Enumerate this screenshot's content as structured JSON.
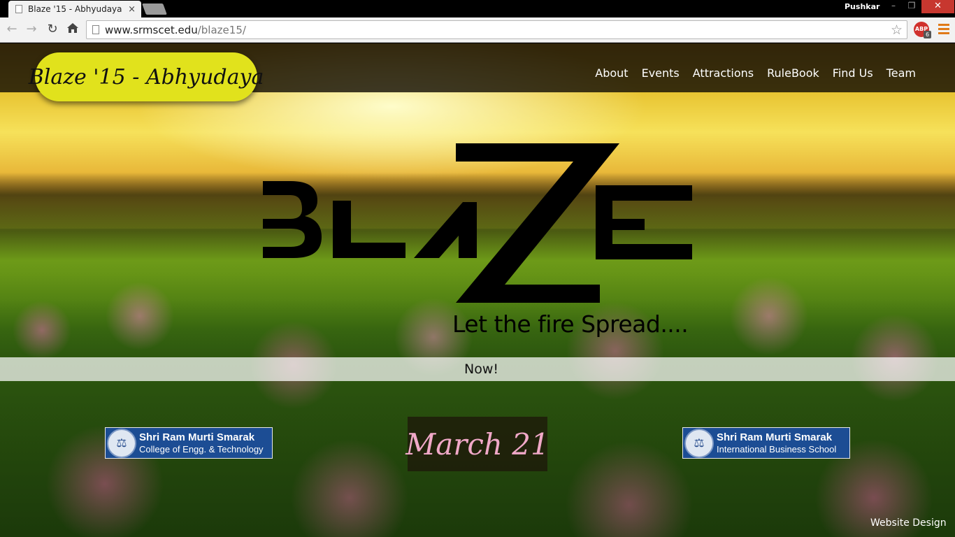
{
  "browser": {
    "tab_title": "Blaze '15 - Abhyudaya",
    "tab_close": "×",
    "profile_name": "Pushkar",
    "url_host": "www.srmscet.edu",
    "url_path": "/blaze15/",
    "abp_label": "ABP",
    "abp_badge": "6",
    "window_close": "✕",
    "window_minimize": "–",
    "window_maximize": "❐"
  },
  "site": {
    "logo_text": "Blaze '15 - Abhyudaya",
    "nav": [
      "About",
      "Events",
      "Attractions",
      "RuleBook",
      "Find Us",
      "Team"
    ],
    "hero_logo_text": "BLAZE",
    "tagline": "Let the fire Spread....",
    "now_text": "Now!",
    "date": "March 21",
    "left_badge": {
      "line1": "Shri Ram Murti Smarak",
      "line2": "College of Engg. & Technology"
    },
    "right_badge": {
      "line1": "Shri Ram Murti Smarak",
      "line2": "International Business School"
    },
    "footer_credit": "Website Design"
  },
  "icons": {
    "back": "back-arrow-icon",
    "forward": "forward-arrow-icon",
    "reload": "reload-icon",
    "home": "home-icon",
    "bookmark": "star-icon",
    "menu": "hamburger-menu-icon",
    "emblem": "college-emblem-icon"
  },
  "colors": {
    "logo_pill": "#e1e21c",
    "header_bar": "#140f05",
    "badge_blue": "#1c4d94",
    "date_text": "#f0a8c8",
    "window_close": "#c7372f"
  }
}
